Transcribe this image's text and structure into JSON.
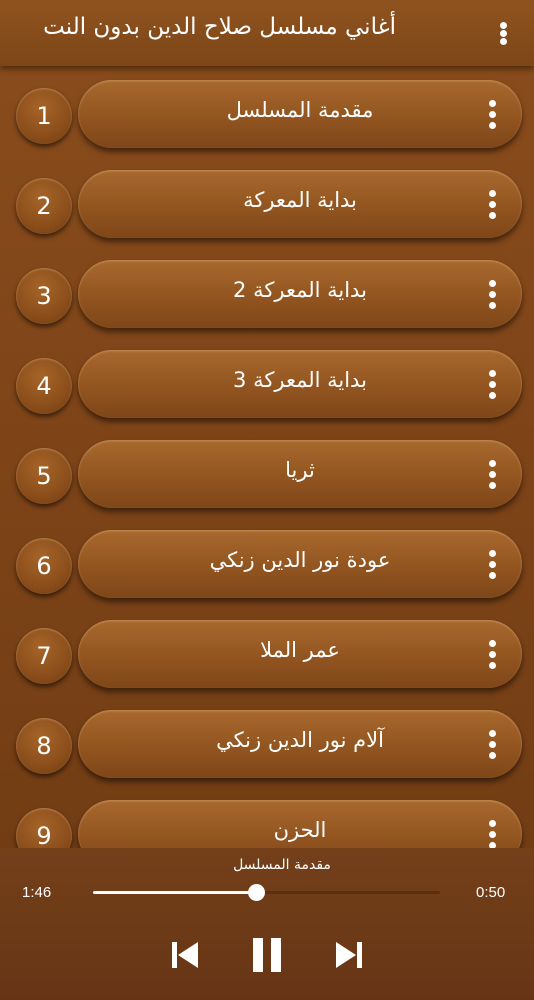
{
  "app_bar": {
    "title": "أغاني مسلسل صلاح الدين بدون النت",
    "menu_icon": "more-vert-icon"
  },
  "tracks": [
    {
      "number": "1",
      "title": "مقدمة المسلسل"
    },
    {
      "number": "2",
      "title": "بداية المعركة"
    },
    {
      "number": "3",
      "title": "بداية المعركة 2"
    },
    {
      "number": "4",
      "title": "بداية المعركة 3"
    },
    {
      "number": "5",
      "title": "ثريا"
    },
    {
      "number": "6",
      "title": "عودة نور الدين زنكي"
    },
    {
      "number": "7",
      "title": "عمر الملا"
    },
    {
      "number": "8",
      "title": "آلام نور الدين زنكي"
    },
    {
      "number": "9",
      "title": "الحزن"
    }
  ],
  "player": {
    "now_playing": "مقدمة المسلسل",
    "elapsed": "1:46",
    "remaining": "0:50",
    "progress": 0.47,
    "controls": [
      "skip-previous-icon",
      "pause-icon",
      "skip-next-icon"
    ]
  },
  "colors": {
    "background": "#7e4418",
    "app_bar": "#8a4f1c",
    "pill": "#925520",
    "text": "#ffffff"
  }
}
